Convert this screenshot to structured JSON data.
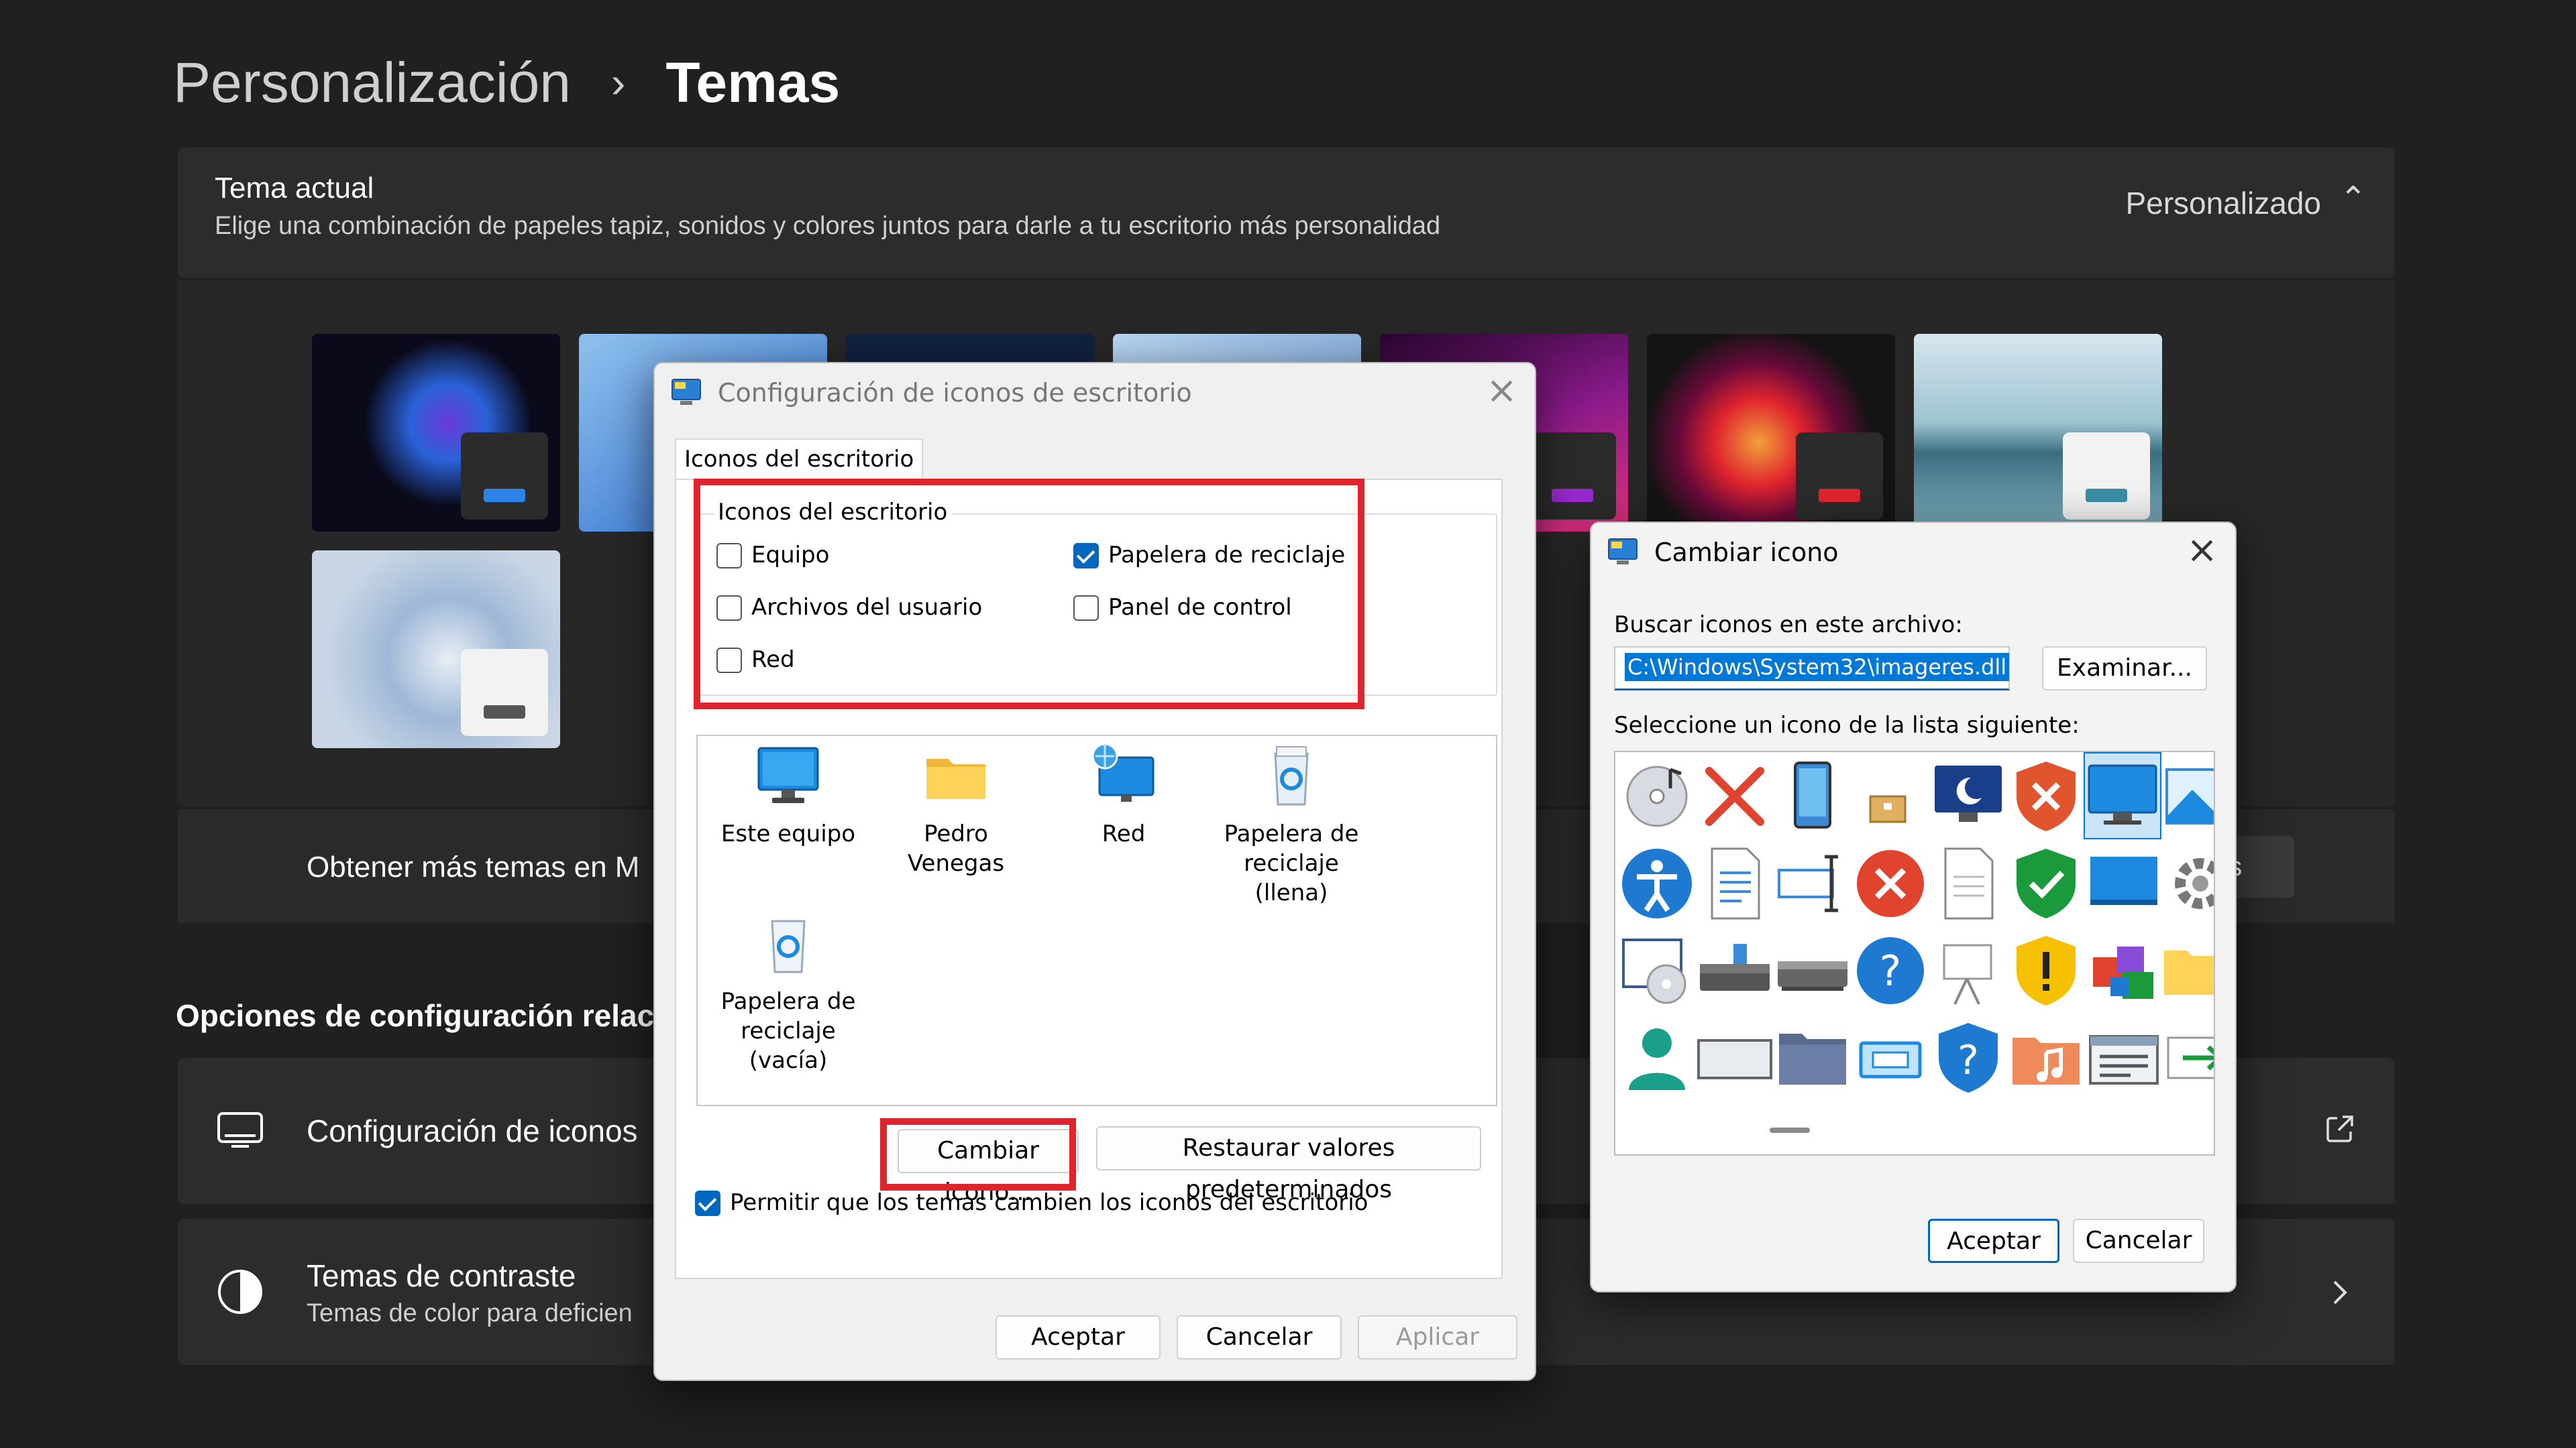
{
  "breadcrumb": {
    "parent": "Personalización",
    "separator": "›",
    "current": "Temas"
  },
  "current_theme": {
    "title": "Tema actual",
    "description": "Elige una combinación de papeles tapiz, sonidos y colores juntos para darle a tu escritorio más personalidad",
    "value": "Personalizado",
    "chevron": "⌃"
  },
  "themes": [
    {
      "bg": "#0a0a1a",
      "accent": "#2b83e8",
      "mini": "#2b2b2b"
    },
    {
      "bg": "#3b7fd6",
      "accent": "#2b83e8",
      "mini": "#d9e6f5"
    },
    {
      "bg": "#10223f",
      "accent": "#2b83e8",
      "mini": "#2b2b2b"
    },
    {
      "bg": "#a8c8ea",
      "accent": "#6a6a9a",
      "mini": "#f2f2f2"
    },
    {
      "bg": "#3a0a3a",
      "accent": "#9a2ad0",
      "mini": "#2b2b2b"
    },
    {
      "bg": "#141414",
      "accent": "#e0242e",
      "mini": "#2b2b2b"
    },
    {
      "bg": "#8fb8c7",
      "accent": "#3a8fa6",
      "mini": "#f2f2f2"
    },
    {
      "bg": "#a9bfd6",
      "accent": "#555555",
      "mini": "#f2f2f2"
    }
  ],
  "more_themes": {
    "label": "Obtener más temas en M",
    "button": "as"
  },
  "related": {
    "title": "Opciones de configuración relacio",
    "desktop_icons": {
      "label": "Configuración de iconos",
      "icon": "monitor-icon",
      "action_icon": "external-link-icon"
    },
    "contrast": {
      "label": "Temas de contraste",
      "sublabel": "Temas de color para deficien",
      "icon": "contrast-icon",
      "action_icon": "chevron-right-icon"
    }
  },
  "desktop_icon_dialog": {
    "title": "Configuración de iconos de escritorio",
    "tab": "Iconos del escritorio",
    "group_label": "Iconos del escritorio",
    "checkboxes": [
      {
        "label": "Equipo",
        "checked": false
      },
      {
        "label": "Papelera de reciclaje",
        "checked": true
      },
      {
        "label": "Archivos del usuario",
        "checked": false
      },
      {
        "label": "Panel de control",
        "checked": false
      },
      {
        "label": "Red",
        "checked": false
      }
    ],
    "icons": [
      {
        "label": "Este equipo",
        "icon": "computer-icon"
      },
      {
        "label": "Pedro Venegas",
        "icon": "folder-icon"
      },
      {
        "label": "Red",
        "icon": "network-icon"
      },
      {
        "label": "Papelera de reciclaje (llena)",
        "icon": "recycle-bin-full-icon"
      },
      {
        "label": "Papelera de reciclaje (vacía)",
        "icon": "recycle-bin-empty-icon"
      }
    ],
    "change_icon": "Cambiar icono...",
    "restore": "Restaurar valores predeterminados",
    "allow_themes": "Permitir que los temas cambien los iconos del escritorio",
    "allow_checked": true,
    "ok": "Aceptar",
    "cancel": "Cancelar",
    "apply": "Aplicar",
    "highlight_color": "#e0242e"
  },
  "change_icon_dialog": {
    "title": "Cambiar icono",
    "search_label": "Buscar iconos en este archivo:",
    "path": "C:\\Windows\\System32\\imageres.dll",
    "browse": "Examinar...",
    "select_label": "Seleccione un icono de la lista siguiente:",
    "ok": "Aceptar",
    "cancel": "Cancelar"
  }
}
